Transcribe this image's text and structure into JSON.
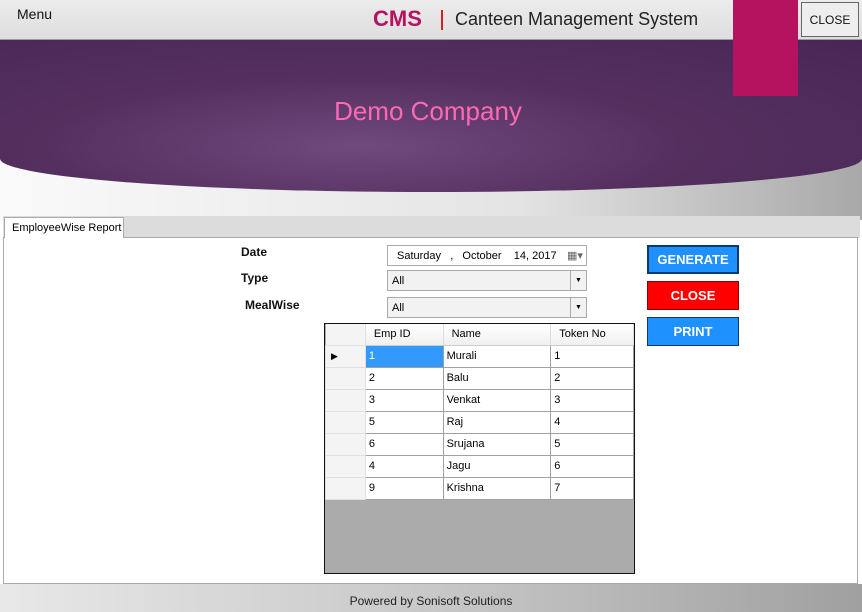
{
  "topbar": {
    "menu": "Menu",
    "logo_mark": "CMS",
    "logo_text": "Canteen Management System",
    "close": "CLOSE"
  },
  "banner": {
    "company": "Demo Company"
  },
  "tabs": [
    {
      "label": "EmployeeWise Report"
    }
  ],
  "form": {
    "date_label": "Date",
    "date_value": "Saturday   ,   October    14, 2017",
    "type_label": "Type",
    "type_value": "All",
    "mealwise_label": "MealWise",
    "mealwise_value": "All"
  },
  "buttons": {
    "generate": "GENERATE",
    "close": "CLOSE",
    "print": "PRINT"
  },
  "colors": {
    "brand": "#b5135f",
    "generate": "#1e90ff",
    "close": "#ff0000",
    "print": "#1e90ff",
    "company": "#ff69b4"
  },
  "grid": {
    "columns": [
      "Emp ID",
      "Name",
      "Token No"
    ],
    "rows": [
      [
        "1",
        "Murali",
        "1"
      ],
      [
        "2",
        "Balu",
        "2"
      ],
      [
        "3",
        "Venkat",
        "3"
      ],
      [
        "5",
        "Raj",
        "4"
      ],
      [
        "6",
        "Srujana",
        "5"
      ],
      [
        "4",
        "Jagu",
        "6"
      ],
      [
        "9",
        "Krishna",
        "7"
      ]
    ]
  },
  "footer": "Powered by Sonisoft Solutions"
}
